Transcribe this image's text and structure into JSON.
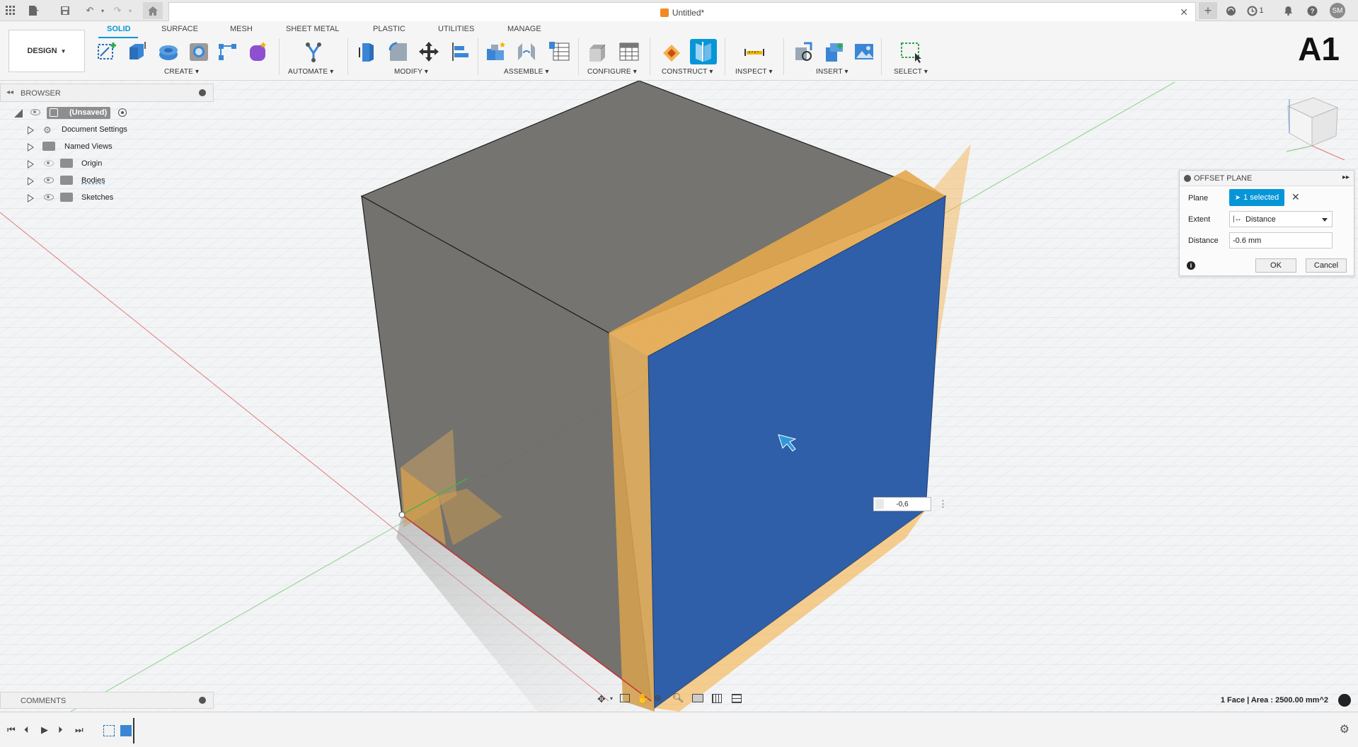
{
  "window": {
    "doc_title": "Untitled*",
    "job_count": "1",
    "user_initials": "SM"
  },
  "ribbon": {
    "workspace_label": "DESIGN",
    "tabs": [
      "SOLID",
      "SURFACE",
      "MESH",
      "SHEET METAL",
      "PLASTIC",
      "UTILITIES",
      "MANAGE"
    ],
    "active_tab": "SOLID",
    "groups": [
      "CREATE",
      "AUTOMATE",
      "MODIFY",
      "ASSEMBLE",
      "CONFIGURE",
      "CONSTRUCT",
      "INSPECT",
      "INSERT",
      "SELECT"
    ],
    "badge": "A1"
  },
  "browser": {
    "title": "BROWSER",
    "root": "(Unsaved)",
    "items": [
      "Document Settings",
      "Named Views",
      "Origin",
      "Bodies",
      "Sketches"
    ]
  },
  "comments": {
    "title": "COMMENTS"
  },
  "dialog": {
    "title": "OFFSET PLANE",
    "plane_label": "Plane",
    "plane_value": "1 selected",
    "extent_label": "Extent",
    "extent_value": "Distance",
    "distance_label": "Distance",
    "distance_value": "-0.6 mm",
    "ok_label": "OK",
    "cancel_label": "Cancel"
  },
  "viewport": {
    "dim_value": "-0,6",
    "status": "1 Face | Area : 2500.00 mm^2"
  },
  "colors": {
    "accent": "#0696d7",
    "face_selected": "#2f5fa8",
    "plane": "#f5b04a",
    "body": "#6b6b66"
  }
}
